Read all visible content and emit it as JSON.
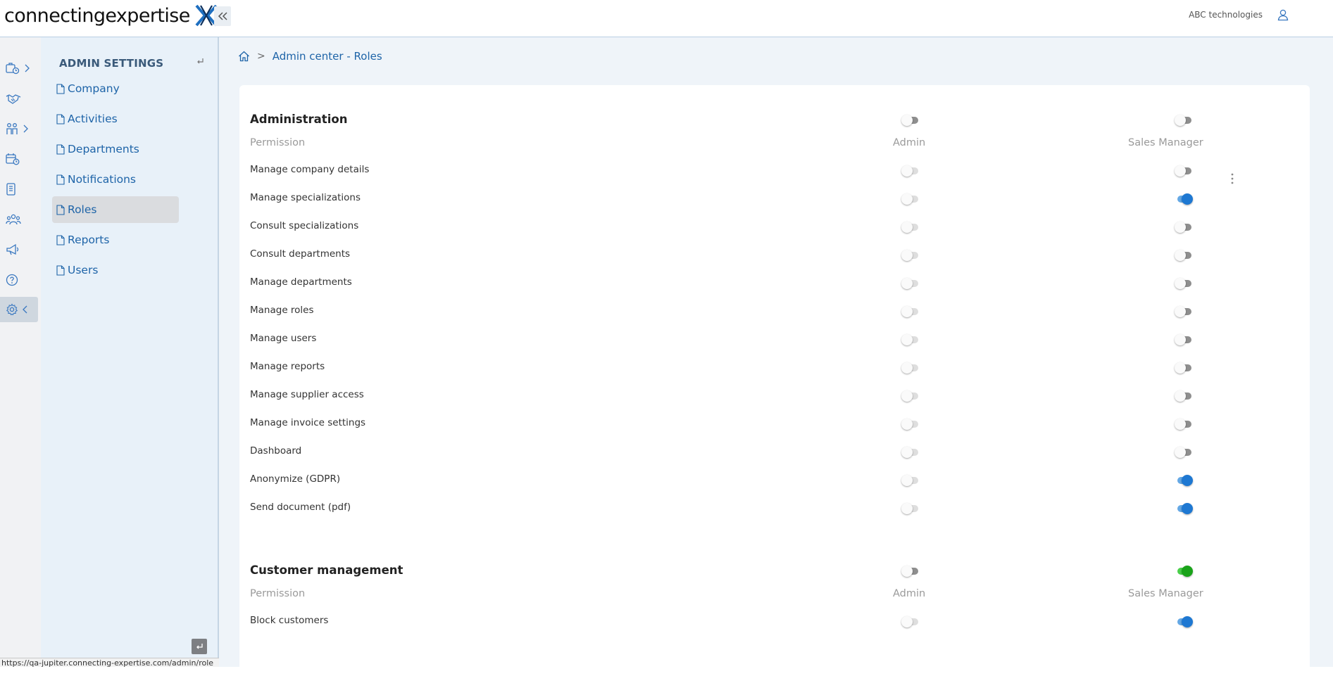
{
  "header": {
    "logo_text": "connectingexpertise",
    "company_name": "ABC technologies"
  },
  "rail": {
    "items": [
      {
        "icon": "briefcase-clock-icon",
        "has_chevron": true
      },
      {
        "icon": "handshake-icon",
        "has_chevron": false
      },
      {
        "icon": "people-icon",
        "has_chevron": true
      },
      {
        "icon": "calendar-clock-icon",
        "has_chevron": false
      },
      {
        "icon": "document-icon",
        "has_chevron": false
      },
      {
        "icon": "group-icon",
        "has_chevron": false
      },
      {
        "icon": "megaphone-icon",
        "has_chevron": false
      },
      {
        "icon": "help-icon",
        "has_chevron": false
      },
      {
        "icon": "gear-icon",
        "has_chevron": true,
        "active": true
      }
    ]
  },
  "admin_panel": {
    "title": "ADMIN SETTINGS",
    "items": [
      {
        "label": "Company"
      },
      {
        "label": "Activities"
      },
      {
        "label": "Departments"
      },
      {
        "label": "Notifications"
      },
      {
        "label": "Roles",
        "active": true
      },
      {
        "label": "Reports"
      },
      {
        "label": "Users"
      }
    ]
  },
  "status_bar": {
    "url": "https://qa-jupiter.connecting-expertise.com/admin/role"
  },
  "breadcrumb": {
    "current": "Admin center - Roles",
    "separator": ">"
  },
  "sections": [
    {
      "title": "Administration",
      "header_toggles": {
        "admin": false,
        "sales_manager": false
      },
      "columns": {
        "permission": "Permission",
        "admin": "Admin",
        "sales_manager": "Sales Manager"
      },
      "rows": [
        {
          "label": "Manage company details",
          "admin": false,
          "sales_manager": false
        },
        {
          "label": "Manage specializations",
          "admin": false,
          "sales_manager": true
        },
        {
          "label": "Consult specializations",
          "admin": false,
          "sales_manager": false
        },
        {
          "label": "Consult departments",
          "admin": false,
          "sales_manager": false
        },
        {
          "label": "Manage departments",
          "admin": false,
          "sales_manager": false
        },
        {
          "label": "Manage roles",
          "admin": false,
          "sales_manager": false
        },
        {
          "label": "Manage users",
          "admin": false,
          "sales_manager": false
        },
        {
          "label": "Manage reports",
          "admin": false,
          "sales_manager": false
        },
        {
          "label": "Manage supplier access",
          "admin": false,
          "sales_manager": false
        },
        {
          "label": "Manage invoice settings",
          "admin": false,
          "sales_manager": false
        },
        {
          "label": "Dashboard",
          "admin": false,
          "sales_manager": false
        },
        {
          "label": "Anonymize (GDPR)",
          "admin": false,
          "sales_manager": true
        },
        {
          "label": "Send document (pdf)",
          "admin": false,
          "sales_manager": true
        }
      ]
    },
    {
      "title": "Customer management",
      "header_toggles": {
        "admin": false,
        "sales_manager": true
      },
      "columns": {
        "permission": "Permission",
        "admin": "Admin",
        "sales_manager": "Sales Manager"
      },
      "rows": [
        {
          "label": "Block customers",
          "admin": false,
          "sales_manager": true
        }
      ]
    }
  ],
  "colors": {
    "link": "#1e64a8",
    "toggle_on_blue": "#1e78d2",
    "toggle_on_green": "#1aa31a",
    "header_border": "#b9cfe3"
  }
}
